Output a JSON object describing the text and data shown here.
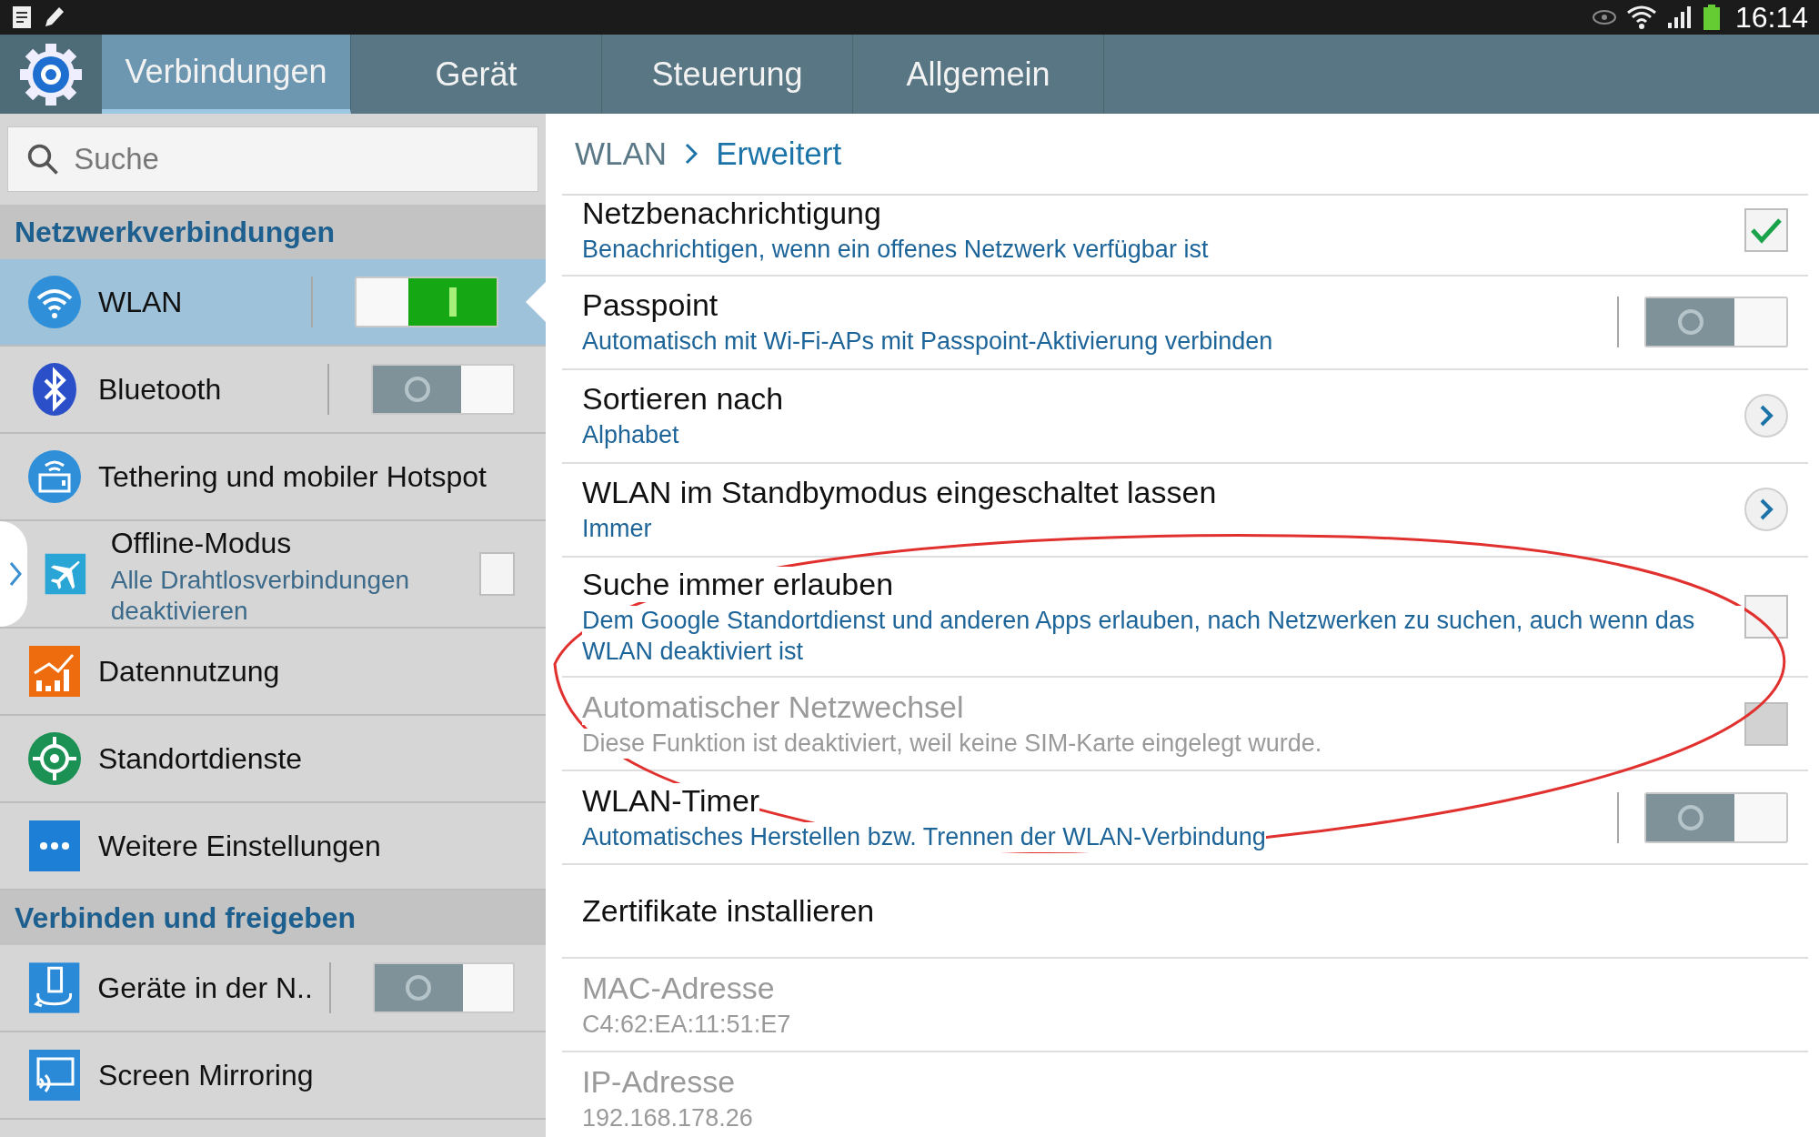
{
  "status_bar": {
    "time": "16:14"
  },
  "tabs": [
    {
      "label": "Verbindungen",
      "selected": true
    },
    {
      "label": "Gerät",
      "selected": false
    },
    {
      "label": "Steuerung",
      "selected": false
    },
    {
      "label": "Allgemein",
      "selected": false
    }
  ],
  "search": {
    "placeholder": "Suche"
  },
  "sidebar": {
    "sections": [
      {
        "title": "Netzwerkverbindungen",
        "items": [
          {
            "label": "WLAN",
            "kind": "toggle",
            "on": true,
            "selected": true
          },
          {
            "label": "Bluetooth",
            "kind": "toggle",
            "on": false,
            "selected": false
          },
          {
            "label": "Tethering und mobiler Hotspot",
            "kind": "plain",
            "selected": false
          },
          {
            "label": "Offline-Modus",
            "subtitle": "Alle Drahtlosverbindungen deaktivieren",
            "kind": "checkbox",
            "checked": false,
            "selected": false
          },
          {
            "label": "Datennutzung",
            "kind": "plain",
            "selected": false
          },
          {
            "label": "Standortdienste",
            "kind": "plain",
            "selected": false
          },
          {
            "label": "Weitere Einstellungen",
            "kind": "plain",
            "selected": false
          }
        ]
      },
      {
        "title": "Verbinden und freigeben",
        "items": [
          {
            "label": "Geräte in der N..",
            "kind": "toggle",
            "on": false,
            "selected": false
          },
          {
            "label": "Screen Mirroring",
            "kind": "plain",
            "selected": false
          }
        ]
      }
    ]
  },
  "breadcrumb": [
    "WLAN",
    "Erweitert"
  ],
  "settings": [
    {
      "title": "Netzbenachrichtigung",
      "subtitle": "Benachrichtigen, wenn ein offenes Netzwerk verfügbar ist",
      "kind": "checkbox",
      "checked": true,
      "disabled": false
    },
    {
      "title": "Passpoint",
      "subtitle": "Automatisch mit Wi-Fi-APs mit Passpoint-Aktivierung verbinden",
      "kind": "toggle",
      "on": false,
      "disabled": false
    },
    {
      "title": "Sortieren nach",
      "subtitle": "Alphabet",
      "kind": "chevron",
      "disabled": false
    },
    {
      "title": "WLAN im Standbymodus eingeschaltet lassen",
      "subtitle": "Immer",
      "kind": "chevron",
      "disabled": false
    },
    {
      "title": "Suche immer erlauben",
      "subtitle": "Dem Google Standortdienst und anderen Apps erlauben, nach Netzwerken zu suchen, auch wenn das WLAN deaktiviert ist",
      "kind": "checkbox",
      "checked": false,
      "disabled": false
    },
    {
      "title": "Automatischer Netzwechsel",
      "subtitle": "Diese Funktion ist deaktiviert, weil keine SIM-Karte eingelegt wurde.",
      "kind": "checkbox",
      "checked": false,
      "disabled": true
    },
    {
      "title": "WLAN-Timer",
      "subtitle": "Automatisches Herstellen bzw. Trennen der WLAN-Verbindung",
      "kind": "toggle",
      "on": false,
      "disabled": false
    },
    {
      "title": "Zertifikate installieren",
      "kind": "plain",
      "disabled": false
    },
    {
      "title": "MAC-Adresse",
      "subtitle": "C4:62:EA:11:51:E7",
      "kind": "info",
      "disabled": true
    },
    {
      "title": "IP-Adresse",
      "subtitle": "192.168.178.26",
      "kind": "info",
      "disabled": true
    }
  ]
}
